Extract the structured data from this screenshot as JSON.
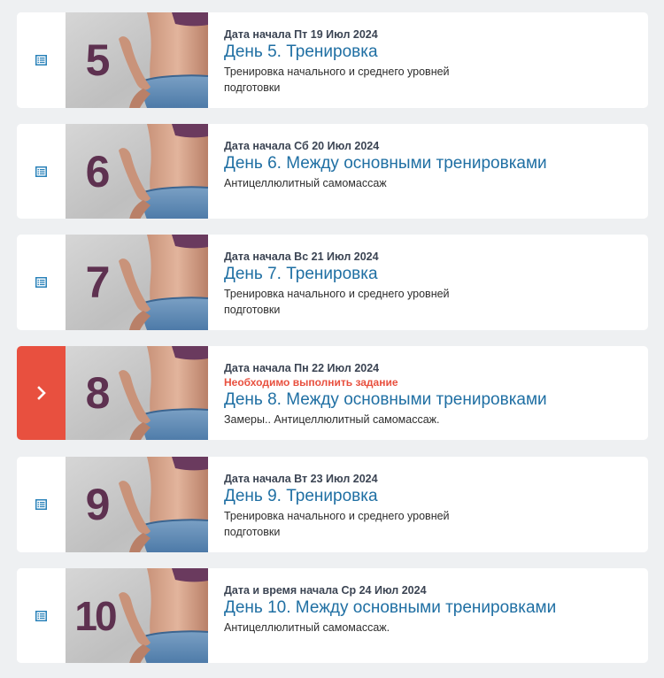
{
  "colors": {
    "background": "#eef0f2",
    "card": "#ffffff",
    "title": "#1f6fa3",
    "accent_active": "#e8503f",
    "number": "#5e3150",
    "icon": "#2a82b9"
  },
  "days": [
    {
      "number": "5",
      "start_date": "Дата начала Пт 19 Июл 2024",
      "warning": "",
      "title": "День 5. Тренировка",
      "description": "Тренировка начального и среднего уровней подготовки",
      "status_icon": "document-icon",
      "active": false
    },
    {
      "number": "6",
      "start_date": "Дата начала Сб 20 Июл 2024",
      "warning": "",
      "title": "День 6. Между основными тренировками",
      "description": "Антицеллюлитный самомассаж",
      "status_icon": "document-icon",
      "active": false
    },
    {
      "number": "7",
      "start_date": "Дата начала Вс 21 Июл 2024",
      "warning": "",
      "title": "День 7. Тренировка",
      "description": "Тренировка начального и среднего уровней подготовки",
      "status_icon": "document-icon",
      "active": false
    },
    {
      "number": "8",
      "start_date": "Дата начала Пн 22 Июл 2024",
      "warning": "Необходимо выполнить задание",
      "title": "День 8. Между основными тренировками",
      "description": "Замеры.. Антицеллюлитный самомассаж.",
      "status_icon": "chevron-right-icon",
      "active": true
    },
    {
      "number": "9",
      "start_date": "Дата начала Вт 23 Июл 2024",
      "warning": "",
      "title": "День 9. Тренировка",
      "description": "Тренировка начального и среднего уровней подготовки",
      "status_icon": "document-icon",
      "active": false
    },
    {
      "number": "10",
      "start_date": "Дата и время начала Ср 24 Июл 2024",
      "warning": "",
      "title": "День 10. Между основными тренировками",
      "description": "Антицеллюлитный самомассаж.",
      "status_icon": "document-icon",
      "active": false
    }
  ]
}
